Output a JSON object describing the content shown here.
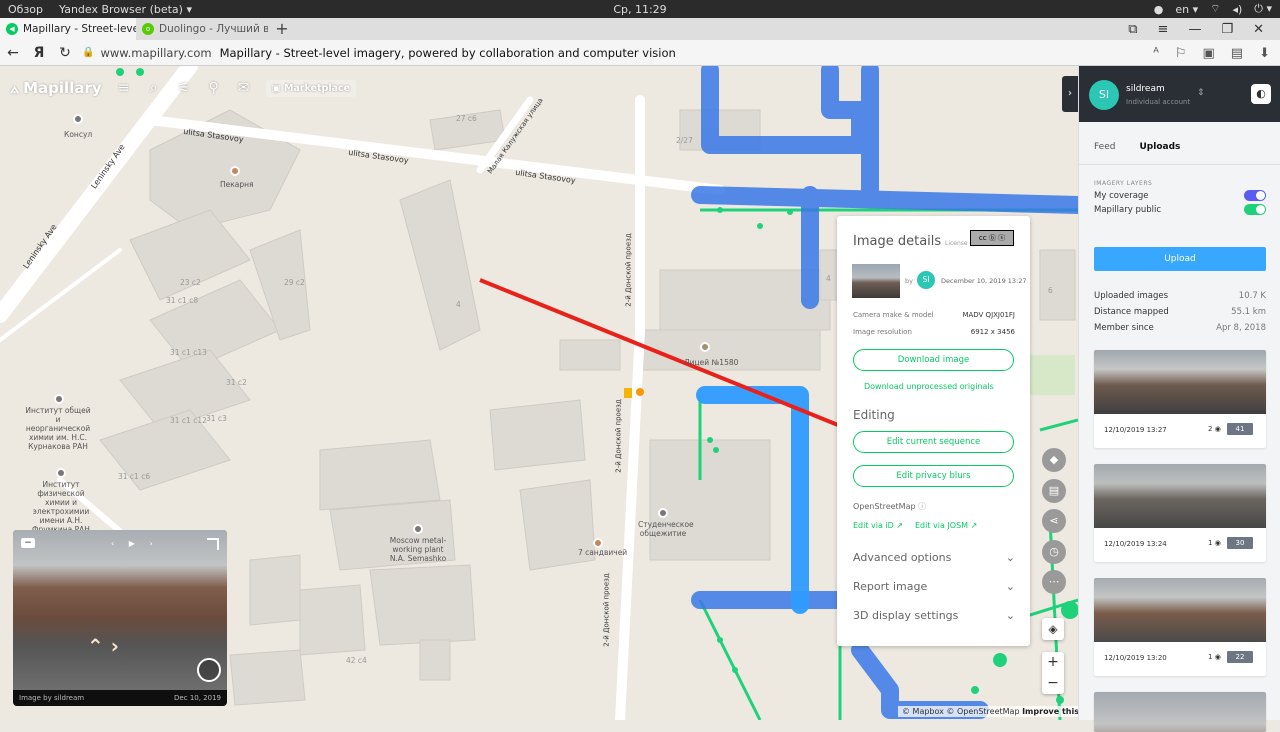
{
  "os": {
    "overview": "Обзор",
    "browser_name": "Yandex Browser (beta) ▾",
    "clock": "Ср, 11:29",
    "lang": "en ▾"
  },
  "tabs": [
    {
      "label": "Mapillary - Street-level i"
    },
    {
      "label": "Duolingo - Лучший в мире"
    }
  ],
  "address": {
    "domain": "www.mapillary.com",
    "title": "Mapillary - Street-level imagery, powered by collaboration and computer vision"
  },
  "topnav": {
    "logo": "Mapillary",
    "marketplace": "Marketplace"
  },
  "map": {
    "streets": [
      {
        "name": "ulitsa Stasovoy"
      },
      {
        "name": "ulitsa Stasovoy"
      },
      {
        "name": "ulitsa Stasovoy"
      },
      {
        "name": "Leninsky Ave"
      },
      {
        "name": "Leninsky Ave"
      },
      {
        "name": "Малая Калужская улица"
      },
      {
        "name": "2-й Донской проезд"
      },
      {
        "name": "2-й Донской проезд"
      },
      {
        "name": "2-й Донской проезд"
      }
    ],
    "pois": [
      {
        "label": "Консул"
      },
      {
        "label": "Пекарня"
      },
      {
        "label": "Лицей №1580"
      },
      {
        "label": "Институт общей и неорганической химии им. Н.С. Курнакова РАН"
      },
      {
        "label": "Институт физической химии и электрохимии имени А.Н. Фрумкина РАН"
      },
      {
        "label": "Студенческое общежитие"
      },
      {
        "label": "7 сандвичей"
      },
      {
        "label": "Moscow metal-working plant N.A. Semashko"
      }
    ],
    "house_numbers": [
      "27 с6",
      "23 с2",
      "4",
      "31 с1 с8",
      "29 с2",
      "31 с1 с13",
      "31 с2",
      "31 с3",
      "31 с1 с12",
      "31 с1 с6",
      "2/27",
      "6",
      "4",
      "42 с4"
    ]
  },
  "details": {
    "title": "Image details",
    "license": "License",
    "cc": "cc ⓑ ⓢ",
    "by": "by",
    "avatar": "SI",
    "date": "December 10, 2019 13:27",
    "camera_label": "Camera make & model",
    "camera_value": "MADV QJXJ01FJ",
    "resolution_label": "Image resolution",
    "resolution_value": "6912 x 3456",
    "download_btn": "Download image",
    "download_link": "Download unprocessed originals",
    "editing_title": "Editing",
    "edit_seq_btn": "Edit current sequence",
    "edit_blur_btn": "Edit privacy blurs",
    "osm_label": "OpenStreetMap",
    "edit_id": "Edit via iD ↗",
    "edit_josm": "Edit via JOSM ↗",
    "advanced": "Advanced options",
    "report": "Report image",
    "display3d": "3D display settings"
  },
  "viewer": {
    "caption_left": "Image by sildream",
    "caption_right": "Dec 10, 2019"
  },
  "attribution": {
    "text": "© Mapbox © OpenStreetMap",
    "improve": "Improve this map"
  },
  "sidebar": {
    "avatar": "SI",
    "username": "sildream",
    "account_type": "Individual account",
    "tab_feed": "Feed",
    "tab_uploads": "Uploads",
    "layers_heading": "IMAGERY LAYERS",
    "layer_my": "My coverage",
    "layer_public": "Mapillary public",
    "upload_btn": "Upload",
    "stats": [
      {
        "label": "Uploaded images",
        "value": "10.7 K"
      },
      {
        "label": "Distance mapped",
        "value": "55.1 km"
      },
      {
        "label": "Member since",
        "value": "Apr 8, 2018"
      }
    ],
    "uploads": [
      {
        "date": "12/10/2019 13:27",
        "views": "2",
        "count": "41"
      },
      {
        "date": "12/10/2019 13:24",
        "views": "1",
        "count": "30"
      },
      {
        "date": "12/10/2019 13:20",
        "views": "1",
        "count": "22"
      }
    ]
  },
  "colors": {
    "brand_green": "#05cb63",
    "upload_blue": "#38a8ff",
    "coverage_blue": "#3a78e8",
    "sequence_blue": "#2f9bff",
    "public_green": "#1fd27a",
    "annotation_red": "#e8221a"
  }
}
